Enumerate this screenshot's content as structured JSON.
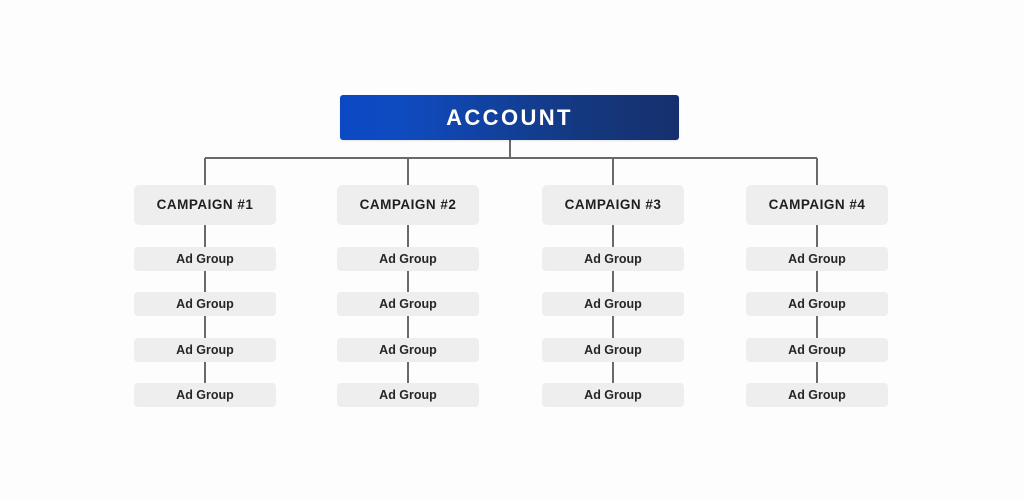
{
  "diagram": {
    "type": "hierarchy-tree",
    "background_color": "#fdfdfd",
    "connector_color": "#6a6a6a",
    "root": {
      "label": "ACCOUNT",
      "gradient_start": "#0f4bc0",
      "gradient_end": "#16306e",
      "text_color": "#ffffff"
    },
    "node_style": {
      "box_color": "#eeeeee",
      "text_color": "#1f1f1f"
    },
    "columns": [
      {
        "campaign_label": "CAMPAIGN #1",
        "ad_groups": [
          {
            "label": "Ad Group"
          },
          {
            "label": "Ad Group"
          },
          {
            "label": "Ad Group"
          },
          {
            "label": "Ad Group"
          }
        ]
      },
      {
        "campaign_label": "CAMPAIGN #2",
        "ad_groups": [
          {
            "label": "Ad Group"
          },
          {
            "label": "Ad Group"
          },
          {
            "label": "Ad Group"
          },
          {
            "label": "Ad Group"
          }
        ]
      },
      {
        "campaign_label": "CAMPAIGN #3",
        "ad_groups": [
          {
            "label": "Ad Group"
          },
          {
            "label": "Ad Group"
          },
          {
            "label": "Ad Group"
          },
          {
            "label": "Ad Group"
          }
        ]
      },
      {
        "campaign_label": "CAMPAIGN #4",
        "ad_groups": [
          {
            "label": "Ad Group"
          },
          {
            "label": "Ad Group"
          },
          {
            "label": "Ad Group"
          },
          {
            "label": "Ad Group"
          }
        ]
      }
    ]
  }
}
